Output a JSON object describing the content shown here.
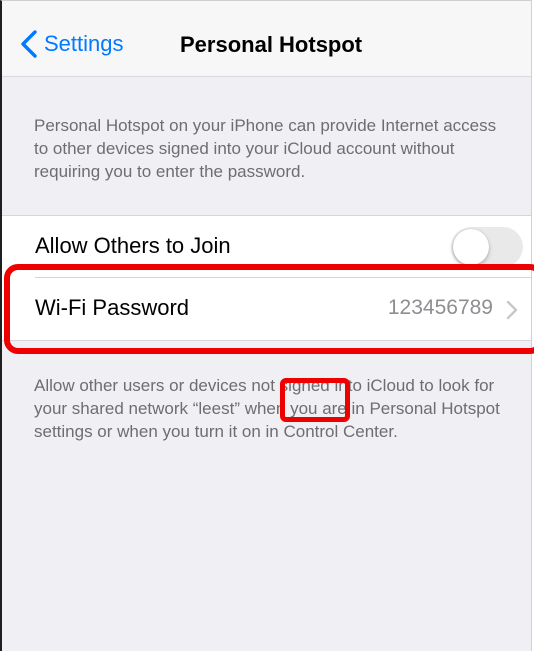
{
  "navigation": {
    "back_label": "Settings",
    "title": "Personal Hotspot",
    "back_icon": "chevron-left-icon"
  },
  "description": "Personal Hotspot on your iPhone can provide Internet access to other devices signed into your iCloud account without requiring you to enter the password.",
  "settings": {
    "allow_others": {
      "label": "Allow Others to Join",
      "enabled": false
    },
    "wifi_password": {
      "label": "Wi-Fi Password",
      "value": "123456789",
      "chevron_icon": "chevron-right-icon"
    }
  },
  "footer": "Allow other users or devices not signed into iCloud to look for your shared network “leest” when you are in Personal Hotspot settings or when you turn it on in Control Center.",
  "colors": {
    "accent": "#007aff",
    "highlight": "#ee0000",
    "background": "#efeff4",
    "secondary_text": "#6d6d72"
  }
}
